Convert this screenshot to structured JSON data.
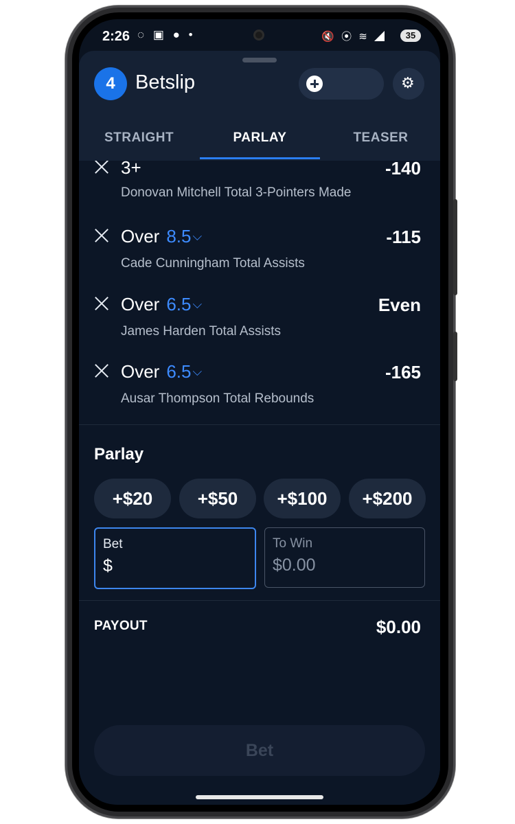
{
  "status_bar": {
    "time": "2:26",
    "left_icons": "◌ ▣ ● •",
    "right_icons": "🔇 ⦿ ≋ ◢",
    "battery": "35"
  },
  "header": {
    "count": "4",
    "title": "Betslip"
  },
  "tabs": [
    {
      "label": "STRAIGHT",
      "active": false
    },
    {
      "label": "PARLAY",
      "active": true
    },
    {
      "label": "TEASER",
      "active": false
    }
  ],
  "legs": [
    {
      "selection": "3+",
      "line": "",
      "odds": "-140",
      "market": "Donovan Mitchell Total 3-Pointers Made"
    },
    {
      "selection": "Over",
      "line": "8.5",
      "odds": "-115",
      "market": "Cade Cunningham Total Assists"
    },
    {
      "selection": "Over",
      "line": "6.5",
      "odds": "Even",
      "market": "James Harden Total Assists"
    },
    {
      "selection": "Over",
      "line": "6.5",
      "odds": "-165",
      "market": "Ausar Thompson Total Rebounds"
    }
  ],
  "parlay": {
    "label": "Parlay",
    "quick_amounts": [
      "+$20",
      "+$50",
      "+$100",
      "+$200"
    ],
    "bet_label": "Bet",
    "bet_value": "$",
    "to_win_label": "To Win",
    "to_win_value": "$0.00",
    "payout_label": "PAYOUT",
    "payout_value": "$0.00"
  },
  "place_bet_label": "Bet",
  "colors": {
    "accent": "#1a73e8",
    "background": "#0c1626",
    "line_value": "#3d8bff"
  }
}
